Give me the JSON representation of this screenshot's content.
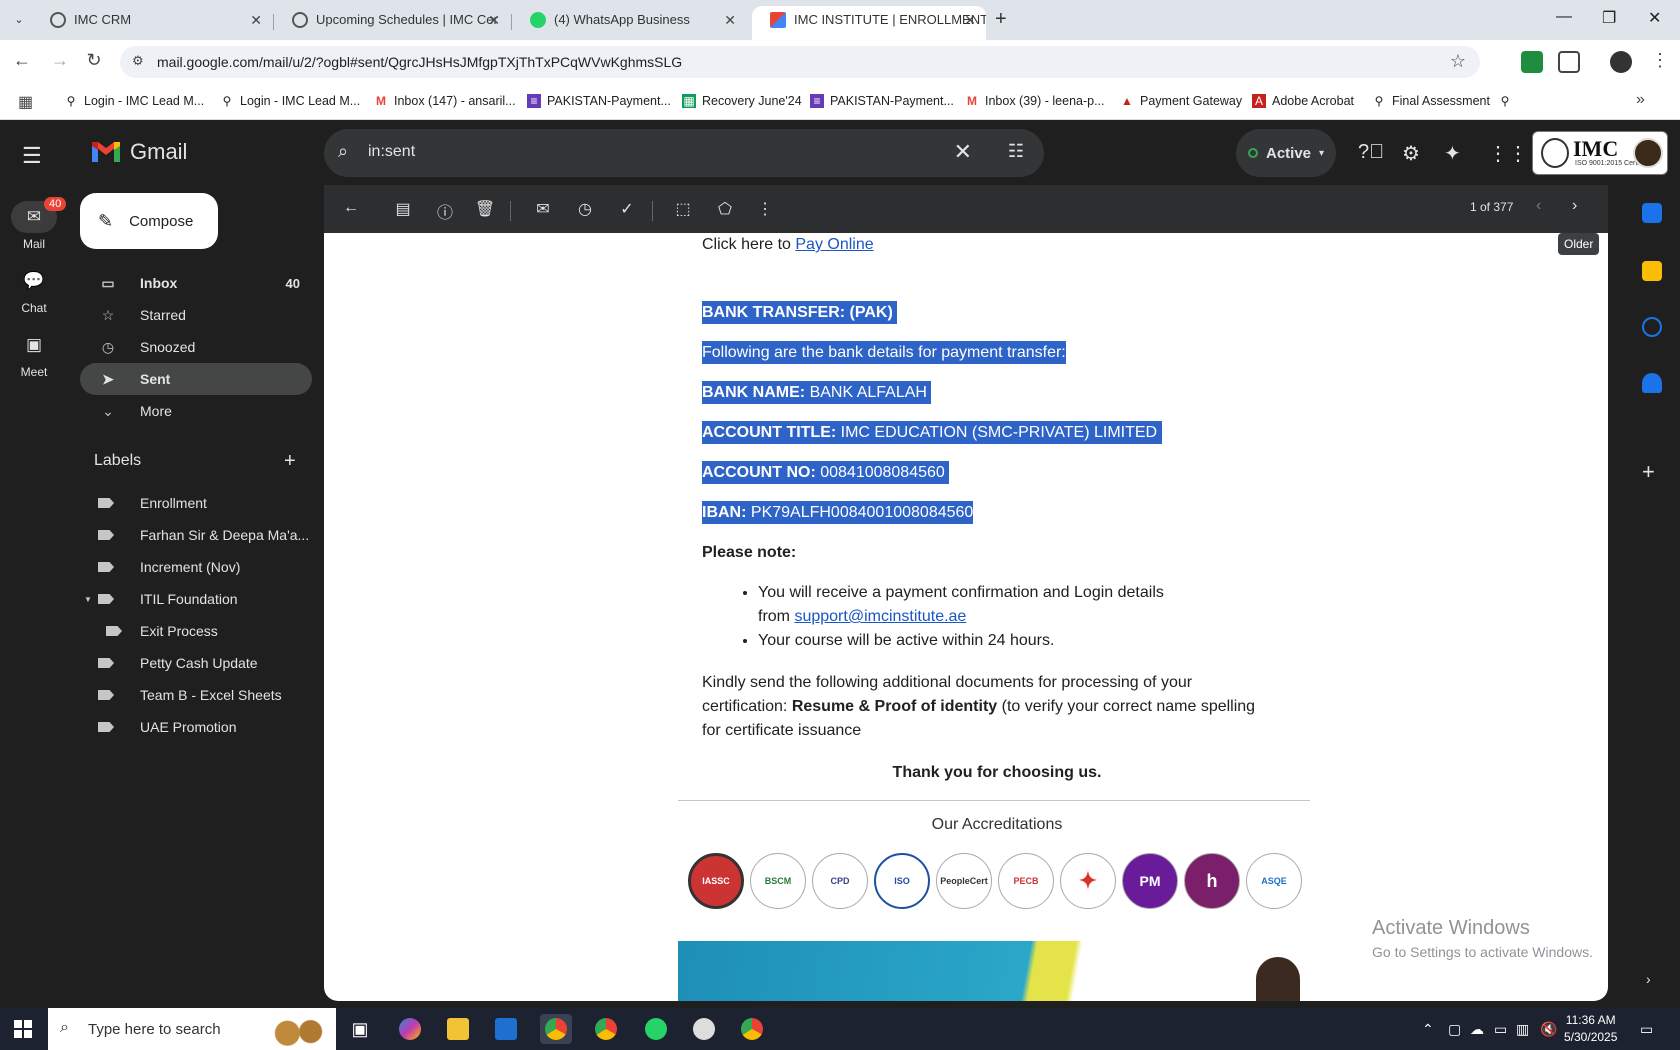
{
  "browser": {
    "tabs": [
      {
        "title": "IMC CRM",
        "active": false
      },
      {
        "title": "Upcoming Schedules | IMC Cer",
        "active": false
      },
      {
        "title": "(4) WhatsApp Business",
        "active": false
      },
      {
        "title": "IMC INSTITUTE | ENROLLMENT",
        "active": true
      }
    ],
    "url": "mail.google.com/mail/u/2/?ogbl#sent/QgrcJHsHsJMfgpTXjThTxPCqWVwKghmsSLG",
    "bookmarks": [
      "Login - IMC Lead M...",
      "Login - IMC Lead M...",
      "Inbox (147) - ansaril...",
      "PAKISTAN-Payment...",
      "Recovery June'24",
      "PAKISTAN-Payment...",
      "Inbox (39) - leena-p...",
      "Payment Gateway",
      "Adobe Acrobat",
      "Final Assessment"
    ]
  },
  "gmail": {
    "brand": "Gmail",
    "rail": [
      {
        "label": "Mail",
        "badge": "40"
      },
      {
        "label": "Chat"
      },
      {
        "label": "Meet"
      }
    ],
    "compose_label": "Compose",
    "search_query": "in:sent",
    "status_label": "Active",
    "imc_logo_text": "IMC",
    "imc_logo_sub": "ISO 9001:2015 Certified",
    "nav": [
      {
        "label": "Inbox",
        "count": "40",
        "bold": true
      },
      {
        "label": "Starred"
      },
      {
        "label": "Snoozed"
      },
      {
        "label": "Sent",
        "active": true
      },
      {
        "label": "More"
      }
    ],
    "labels_title": "Labels",
    "labels": [
      "Enrollment",
      "Farhan Sir & Deepa Ma'a...",
      "Increment (Nov)",
      "ITIL Foundation",
      "Exit Process",
      "Petty Cash Update",
      "Team B - Excel Sheets",
      "UAE Promotion"
    ],
    "pager": "1 of 377",
    "tooltip_older": "Older"
  },
  "email": {
    "pay_prefix": "Click here to",
    "pay_link": "Pay Online",
    "bank_heading": "BANK TRANSFER: (PAK)",
    "bank_intro": "Following are the bank details for payment transfer:",
    "bank_name_label": "BANK NAME:",
    "bank_name_value": "BANK ALFALAH",
    "account_title_label": "ACCOUNT TITLE:",
    "account_title_value": "IMC EDUCATION (SMC-PRIVATE) LIMITED",
    "account_no_label": "ACCOUNT NO:",
    "account_no_value": "00841008084560",
    "iban_label": "IBAN:",
    "iban_value": "PK79ALFH0084001008084560",
    "note_heading": "Please note:",
    "bullet1_text": "You will receive a payment confirmation and Login details",
    "bullet1_from": "from",
    "bullet1_email": "support@imcinstitute.ae",
    "bullet2_text": "Your course will be active within 24 hours.",
    "docs_line1": "Kindly send the following additional documents for processing of your",
    "docs_prefix": "certification:",
    "docs_bold": "Resume & Proof of identity",
    "docs_suffix": "(to verify your correct name spelling",
    "docs_line3": "for certificate issuance",
    "thanks": "Thank you for choosing us.",
    "accreditations_title": "Our Accreditations",
    "accreditation_badges": [
      "IASSC",
      "BSCM",
      "CPD",
      "ISO",
      "PeopleCert",
      "PECB",
      "",
      "PM",
      "h",
      "ASQE"
    ]
  },
  "windows": {
    "activate_title": "Activate Windows",
    "activate_sub": "Go to Settings to activate Windows.",
    "search_placeholder": "Type here to search",
    "time": "11:36 AM",
    "date": "5/30/2025"
  }
}
